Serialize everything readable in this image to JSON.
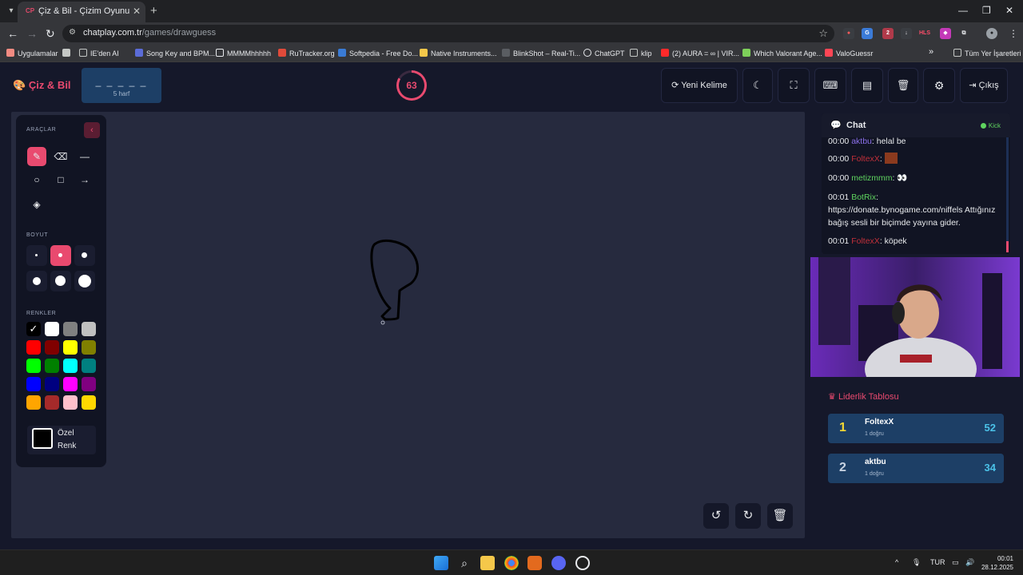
{
  "browser": {
    "tab_title": "Çiz & Bil - Çizim Oyunu",
    "tab_favicon": "CP",
    "url_host": "chatplay.com.tr",
    "url_path": "/games/drawguess",
    "bookmarks": [
      {
        "label": "Uygulamalar",
        "icon": "apps-grid-icon",
        "color": "#f28b82"
      },
      {
        "label": "",
        "icon": "grid-icon",
        "color": "#e8eaed"
      },
      {
        "label": "IE'den AI",
        "icon": "folder-icon",
        "color": "#e8eaed"
      },
      {
        "label": "Song Key and BPM...",
        "icon": "v-icon",
        "color": "#5b6cd8"
      },
      {
        "label": "MMMMhhhhh",
        "icon": "s-icon",
        "color": "#e8eaed"
      },
      {
        "label": "RuTracker.org",
        "icon": "rutracker-icon",
        "color": "#e04a3a"
      },
      {
        "label": "Softpedia - Free Do...",
        "icon": "softpedia-icon",
        "color": "#3a7bd5"
      },
      {
        "label": "Native Instruments...",
        "icon": "folder-icon",
        "color": "#f5c84a"
      },
      {
        "label": "BlinkShot – Real-Ti...",
        "icon": "bs-icon",
        "color": "#e8eaed"
      },
      {
        "label": "ChatGPT",
        "icon": "chatgpt-icon",
        "color": "#e8eaed"
      },
      {
        "label": "klip",
        "icon": "folder-icon",
        "color": "#e8eaed"
      },
      {
        "label": "(2) AURA = ∞ | VIR...",
        "icon": "youtube-icon",
        "color": "#ff2a2a"
      },
      {
        "label": "Which Valorant Age...",
        "icon": "valorant-icon",
        "color": "#7ecf5a"
      },
      {
        "label": "ValoGuessr",
        "icon": "valoguessr-icon",
        "color": "#ff4655"
      }
    ],
    "more_bookmarks": "»",
    "all_bookmarks": "Tüm Yer İşaretleri"
  },
  "header": {
    "brand": "Çiz & Bil",
    "word_mask": "_ _ _ _ _",
    "word_length": "5 harf",
    "timer": "63",
    "new_word": "Yeni Kelime",
    "exit": "Çıkış"
  },
  "tools_panel": {
    "tools_label": "ARAÇLAR",
    "size_label": "BOYUT",
    "colors_label": "RENKLER",
    "custom_color_label": "Özel Renk",
    "colors": [
      "#000000",
      "#ffffff",
      "#808080",
      "#c0c0c0",
      "#ff0000",
      "#800000",
      "#ffff00",
      "#808000",
      "#00ff00",
      "#008000",
      "#00ffff",
      "#008080",
      "#0000ff",
      "#000080",
      "#ff00ff",
      "#800080",
      "#ffa500",
      "#a52a2a",
      "#ffc0cb",
      "#ffd700"
    ],
    "selected_color_index": 0
  },
  "chat": {
    "title": "Chat",
    "platform": "Kick",
    "messages": [
      {
        "time": "00:00",
        "user": "aktbu",
        "user_color": "#8a6fe8",
        "text": "helal be"
      },
      {
        "time": "00:00",
        "user": "FoltexX",
        "user_color": "#c2303a",
        "text": "",
        "emote": true
      },
      {
        "time": "00:00",
        "user": "metizmmm",
        "user_color": "#5fd45f",
        "text": "👀"
      },
      {
        "time": "00:01",
        "user": "BotRix",
        "user_color": "#5fd45f",
        "text": "https://donate.bynogame.com/niffels Attığınız bağış sesli bir biçimde yayına gider."
      },
      {
        "time": "00:01",
        "user": "FoltexX",
        "user_color": "#c2303a",
        "text": "köpek"
      }
    ]
  },
  "leaderboard": {
    "title": "Liderlik Tablosu",
    "rows": [
      {
        "rank": "1",
        "name": "FoltexX",
        "sub": "1 doğru",
        "score": "52",
        "rank_color": "#f5d833"
      },
      {
        "rank": "2",
        "name": "aktbu",
        "sub": "1 doğru",
        "score": "34",
        "rank_color": "#c9d4e3"
      }
    ]
  },
  "taskbar": {
    "language": "TUR",
    "time": "00:01",
    "date": "28.12.2025"
  }
}
